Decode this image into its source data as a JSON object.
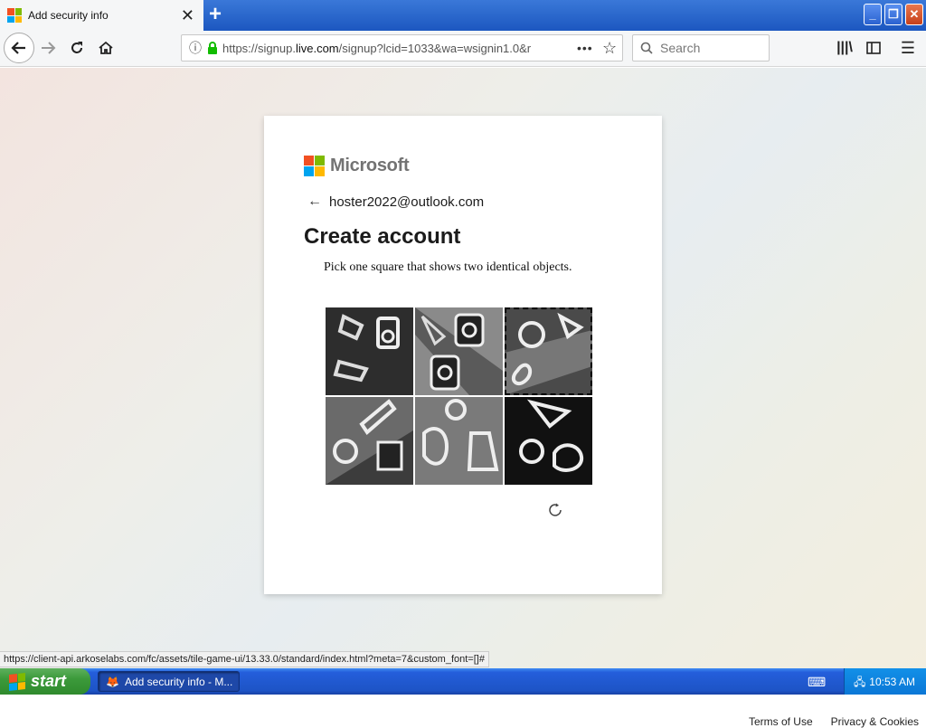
{
  "browser": {
    "tab_title": "Add security info",
    "url_prefix": "https://signup.",
    "url_domain": "live.com",
    "url_rest": "/signup?lcid=1033&wa=wsignin1.0&r",
    "search_placeholder": "Search"
  },
  "page": {
    "brand": "Microsoft",
    "email": "hoster2022@outlook.com",
    "heading": "Create account",
    "instruction": "Pick one square that shows two identical objects.",
    "selected_tile": 3
  },
  "status_url": "https://client-api.arkoselabs.com/fc/assets/tile-game-ui/13.33.0/standard/index.html?meta=7&custom_font=[]#",
  "footer": {
    "terms": "Terms of Use",
    "privacy": "Privacy & Cookies"
  },
  "taskbar": {
    "start_label": "start",
    "task_label": "Add security info - M...",
    "clock": "10:53 AM"
  },
  "colors": {
    "accent": "#245edb",
    "ms_red": "#f25022",
    "ms_green": "#7fba00",
    "ms_blue": "#00a4ef",
    "ms_yellow": "#ffb900"
  }
}
